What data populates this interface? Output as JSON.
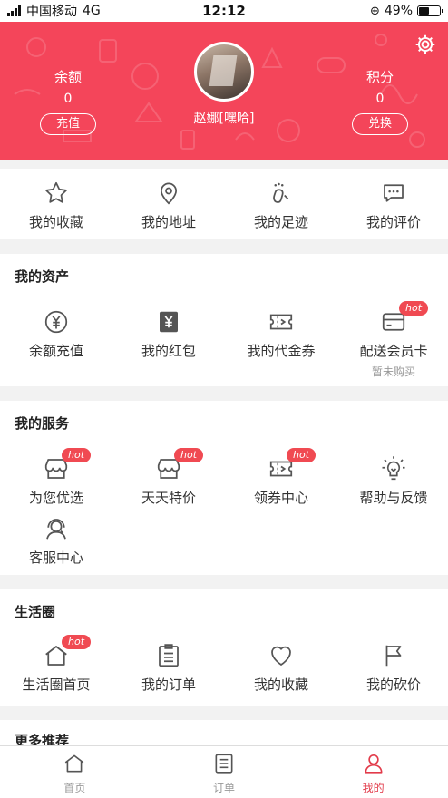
{
  "status_bar": {
    "carrier": "中国移动",
    "network": "4G",
    "time": "12:12",
    "battery": "49%"
  },
  "header": {
    "balance": {
      "label": "余额",
      "value": "0",
      "button": "充值"
    },
    "points": {
      "label": "积分",
      "value": "0",
      "button": "兑换"
    },
    "username": "赵娜[嘿哈]"
  },
  "quick_links": [
    {
      "label": "我的收藏",
      "icon": "star-icon"
    },
    {
      "label": "我的地址",
      "icon": "location-icon"
    },
    {
      "label": "我的足迹",
      "icon": "footprint-icon"
    },
    {
      "label": "我的评价",
      "icon": "comment-icon"
    }
  ],
  "assets": {
    "title": "我的资产",
    "items": [
      {
        "label": "余额充值",
        "icon": "yen-coin-icon"
      },
      {
        "label": "我的红包",
        "icon": "red-packet-icon"
      },
      {
        "label": "我的代金券",
        "icon": "voucher-icon"
      },
      {
        "label": "配送会员卡",
        "icon": "card-icon",
        "badge": "hot",
        "sub": "暂未购买"
      }
    ]
  },
  "services": {
    "title": "我的服务",
    "items": [
      {
        "label": "为您优选",
        "icon": "store-icon",
        "badge": "hot"
      },
      {
        "label": "天天特价",
        "icon": "store-icon",
        "badge": "hot"
      },
      {
        "label": "领券中心",
        "icon": "ticket-icon",
        "badge": "hot"
      },
      {
        "label": "帮助与反馈",
        "icon": "lightbulb-icon"
      },
      {
        "label": "客服中心",
        "icon": "headset-icon"
      }
    ]
  },
  "life": {
    "title": "生活圈",
    "items": [
      {
        "label": "生活圈首页",
        "icon": "home-icon",
        "badge": "hot"
      },
      {
        "label": "我的订单",
        "icon": "list-icon"
      },
      {
        "label": "我的收藏",
        "icon": "heart-icon"
      },
      {
        "label": "我的砍价",
        "icon": "flag-icon"
      }
    ]
  },
  "more": {
    "title": "更多推荐"
  },
  "tabbar": [
    {
      "label": "首页",
      "icon": "home-icon"
    },
    {
      "label": "订单",
      "icon": "order-icon"
    },
    {
      "label": "我的",
      "icon": "user-icon"
    }
  ],
  "colors": {
    "brand": "#f4455a",
    "badge": "#f04a52",
    "active_tab": "#e23b4a"
  }
}
